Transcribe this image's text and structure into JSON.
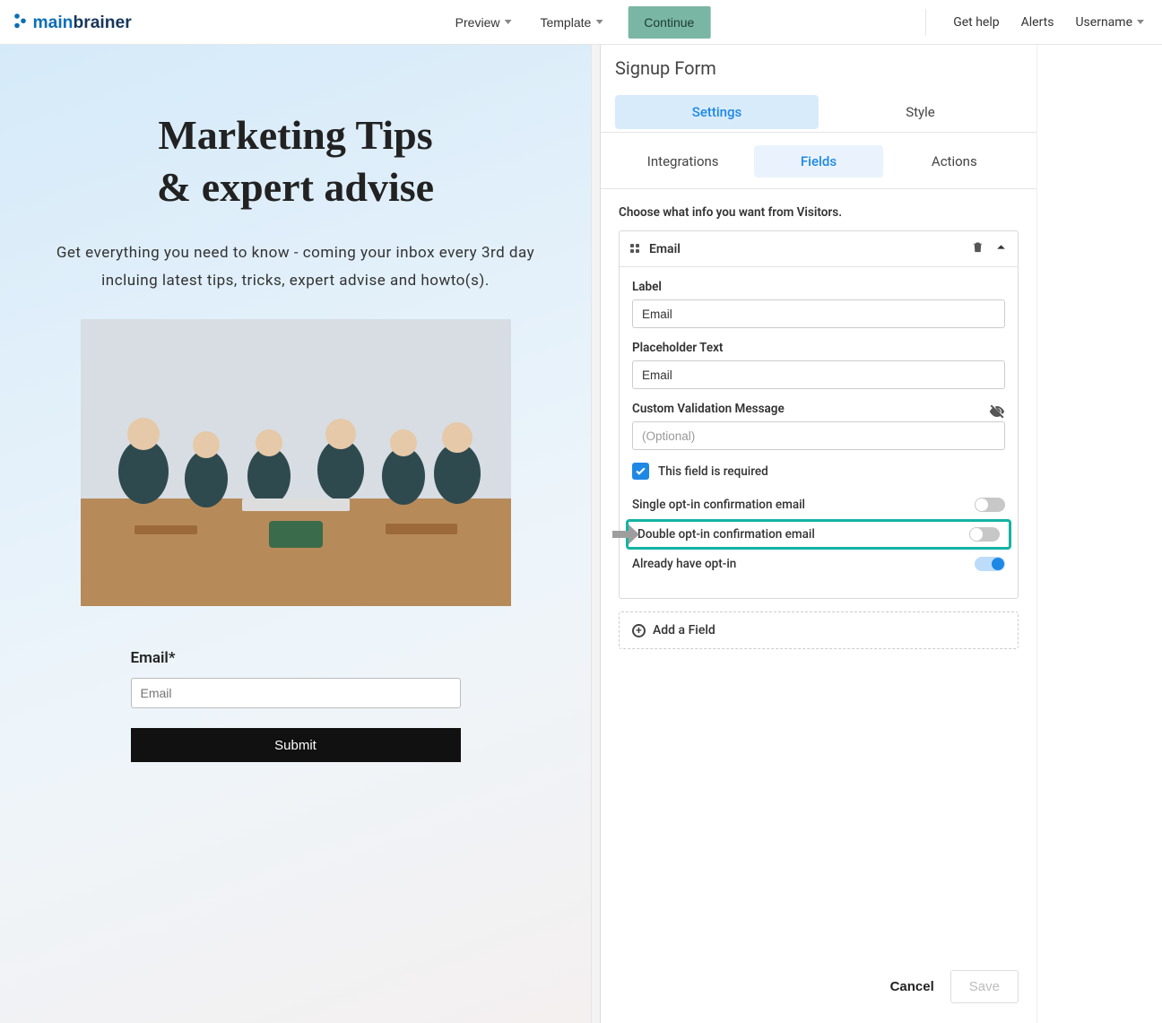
{
  "topbar": {
    "preview": "Preview",
    "template": "Template",
    "continue": "Continue",
    "get_help": "Get help",
    "alerts": "Alerts",
    "username": "Username"
  },
  "hero": {
    "title_l1": "Marketing Tips",
    "title_l2": "& expert advise",
    "subtitle": "Get everything you need to know - coming your inbox every 3rd day incluing latest tips, tricks, expert advise and howto(s).",
    "email_label": "Email*",
    "email_placeholder": "Email",
    "submit": "Submit"
  },
  "panel": {
    "title": "Signup Form",
    "tabs": {
      "settings": "Settings",
      "style": "Style"
    },
    "subtabs": {
      "integrations": "Integrations",
      "fields": "Fields",
      "actions": "Actions"
    },
    "helper": "Choose what info you want from Visitors.",
    "field": {
      "title": "Email",
      "label_lbl": "Label",
      "label_value": "Email",
      "placeholder_lbl": "Placeholder Text",
      "placeholder_value": "Email",
      "custom_validation_lbl": "Custom Validation Message",
      "custom_validation_placeholder": "(Optional)",
      "required_lbl": "This field is required",
      "single_optin": "Single opt-in confirmation email",
      "double_optin": "Double opt-in confirmation email",
      "already_optin": "Already have opt-in"
    },
    "add_field": "Add a Field",
    "cancel": "Cancel",
    "save": "Save"
  }
}
